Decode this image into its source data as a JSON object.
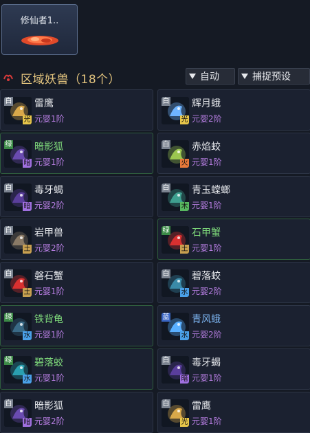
{
  "top_card": {
    "name": "修仙者1.."
  },
  "header": {
    "title": "区域妖兽（18个）",
    "auto_label": "自动",
    "preset_label": "捕捉预设"
  },
  "beasts": [
    {
      "name": "雷鹰",
      "grade": "白",
      "element": "光",
      "realm": "元婴1阶",
      "grade_color": "#7b8390",
      "element_color": "#e8c64a",
      "icon_color": "#d9a84a"
    },
    {
      "name": "辉月蛾",
      "grade": "白",
      "element": "光",
      "realm": "元婴2阶",
      "grade_color": "#7b8390",
      "element_color": "#e8c64a",
      "icon_color": "#6fb4ff"
    },
    {
      "name": "暗影狐",
      "grade": "绿",
      "element": "暗",
      "realm": "元婴1阶",
      "grade_color": "#3b8a46",
      "element_color": "#a070e0",
      "icon_color": "#6a4bb0"
    },
    {
      "name": "赤焰蛟",
      "grade": "白",
      "element": "火",
      "realm": "元婴1阶",
      "grade_color": "#7b8390",
      "element_color": "#e87a3a",
      "icon_color": "#9bc650"
    },
    {
      "name": "毒牙蝎",
      "grade": "白",
      "element": "暗",
      "realm": "元婴2阶",
      "grade_color": "#7b8390",
      "element_color": "#a070e0",
      "icon_color": "#5a3e9c"
    },
    {
      "name": "青玉螳螂",
      "grade": "白",
      "element": "木",
      "realm": "元婴1阶",
      "grade_color": "#7b8390",
      "element_color": "#58b860",
      "icon_color": "#3fa090"
    },
    {
      "name": "岩甲兽",
      "grade": "白",
      "element": "土",
      "realm": "元婴2阶",
      "grade_color": "#7b8390",
      "element_color": "#c8a050",
      "icon_color": "#8a7a66"
    },
    {
      "name": "石甲蟹",
      "grade": "绿",
      "element": "土",
      "realm": "元婴1阶",
      "grade_color": "#3b8a46",
      "element_color": "#c8a050",
      "icon_color": "#d83030"
    },
    {
      "name": "磐石蟹",
      "grade": "白",
      "element": "土",
      "realm": "元婴1阶",
      "grade_color": "#7b8390",
      "element_color": "#c8a050",
      "icon_color": "#d83030"
    },
    {
      "name": "碧落蛟",
      "grade": "白",
      "element": "水",
      "realm": "元婴2阶",
      "grade_color": "#7b8390",
      "element_color": "#4aa0e8",
      "icon_color": "#3a8aa8"
    },
    {
      "name": "铁背龟",
      "grade": "绿",
      "element": "水",
      "realm": "元婴1阶",
      "grade_color": "#3b8a46",
      "element_color": "#4aa0e8",
      "icon_color": "#3a6a86"
    },
    {
      "name": "青风蛾",
      "grade": "蓝",
      "element": "水",
      "realm": "元婴2阶",
      "grade_color": "#3a66c4",
      "element_color": "#4aa0e8",
      "icon_color": "#5ab0ff"
    },
    {
      "name": "碧落蛟",
      "grade": "绿",
      "element": "水",
      "realm": "元婴1阶",
      "grade_color": "#3b8a46",
      "element_color": "#4aa0e8",
      "icon_color": "#2aa0b0"
    },
    {
      "name": "毒牙蝎",
      "grade": "白",
      "element": "暗",
      "realm": "元婴1阶",
      "grade_color": "#7b8390",
      "element_color": "#a070e0",
      "icon_color": "#5a3e9c"
    },
    {
      "name": "暗影狐",
      "grade": "白",
      "element": "暗",
      "realm": "元婴2阶",
      "grade_color": "#7b8390",
      "element_color": "#a070e0",
      "icon_color": "#6a4bb0"
    },
    {
      "name": "雷鹰",
      "grade": "白",
      "element": "光",
      "realm": "元婴1阶",
      "grade_color": "#7b8390",
      "element_color": "#e8c64a",
      "icon_color": "#d9a84a"
    }
  ]
}
